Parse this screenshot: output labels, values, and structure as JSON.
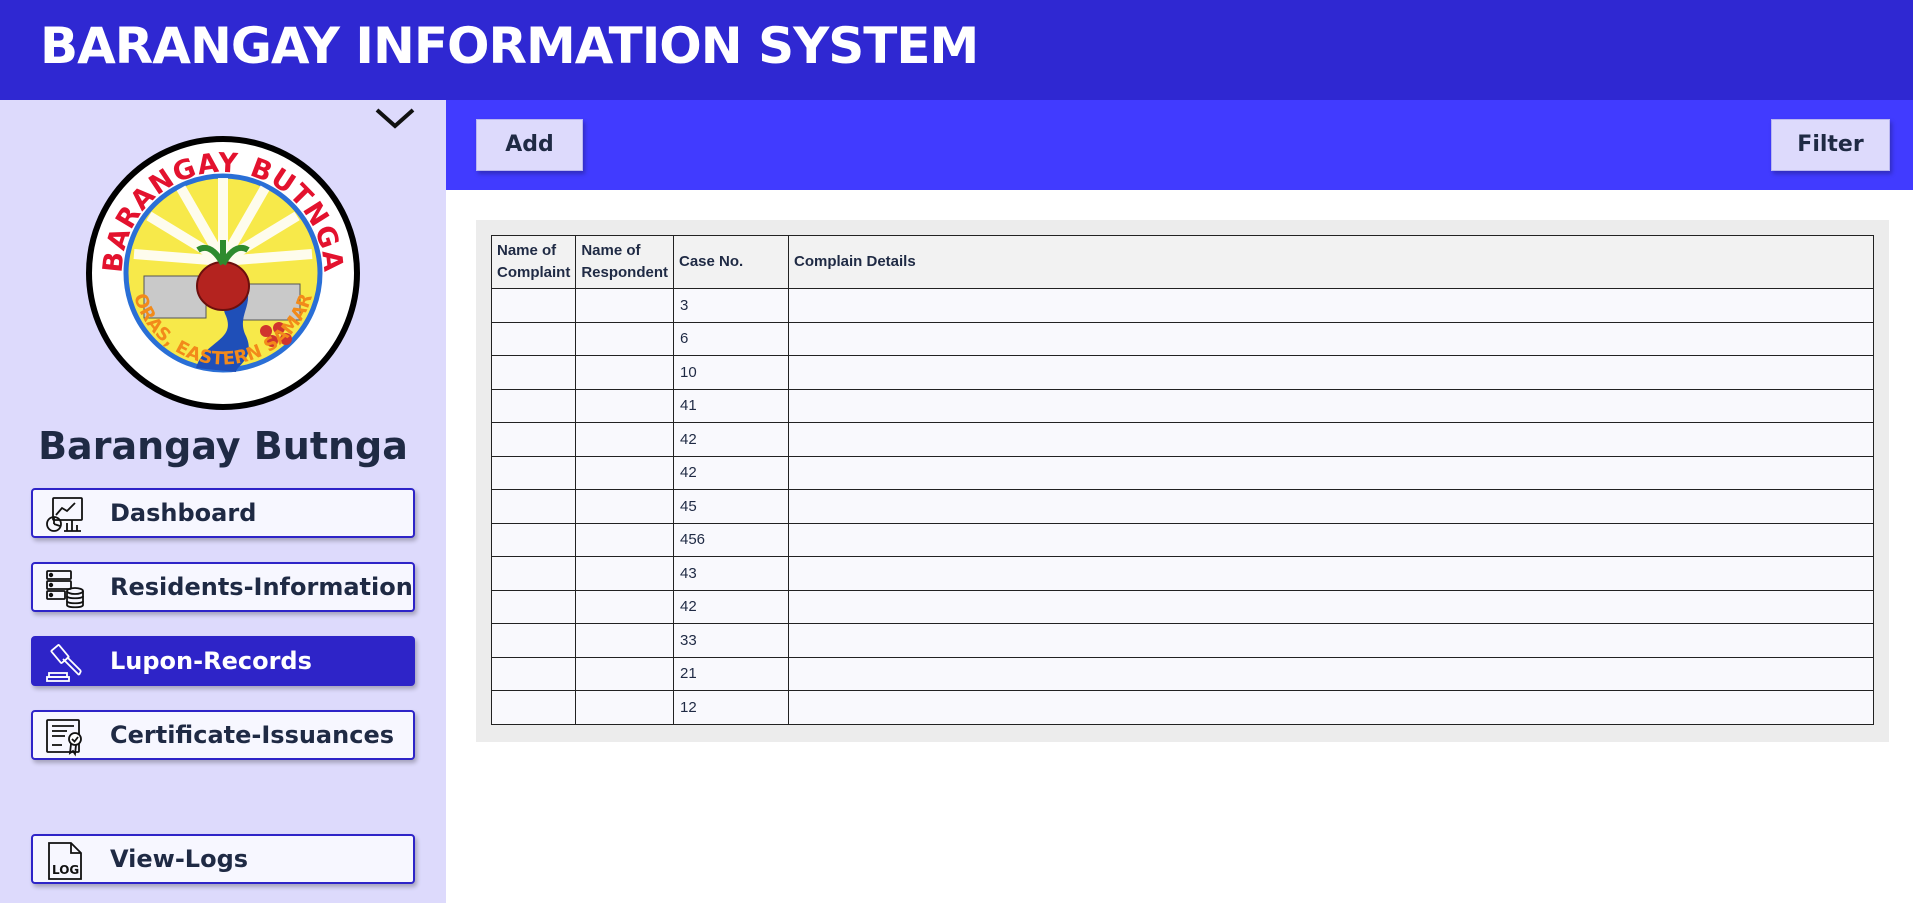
{
  "app": {
    "title": "BARANGAY INFORMATION SYSTEM"
  },
  "sidebar": {
    "barangay_name": "Barangay Butnga",
    "logo": {
      "top_text": "BARANGAY BUTNGA",
      "bottom_text": "ORAS, EASTERN SAMAR"
    },
    "collapse_icon": "chevron-down-icon",
    "items": [
      {
        "label": "Dashboard",
        "icon": "dashboard-icon",
        "active": false
      },
      {
        "label": "Residents-Information",
        "icon": "database-icon",
        "active": false
      },
      {
        "label": "Lupon-Records",
        "icon": "gavel-icon",
        "active": true
      },
      {
        "label": "Certificate-Issuances",
        "icon": "certificate-icon",
        "active": false
      },
      {
        "label": "View-Logs",
        "icon": "log-file-icon",
        "active": false
      }
    ]
  },
  "toolbar": {
    "add_label": "Add",
    "filter_label": "Filter"
  },
  "table": {
    "headers": [
      "Name of Complaint",
      "Name of Respondent",
      "Case No.",
      "Complain Details"
    ],
    "rows": [
      [
        "",
        "",
        "3",
        ""
      ],
      [
        "",
        "",
        "6",
        ""
      ],
      [
        "",
        "",
        "10",
        ""
      ],
      [
        "",
        "",
        "41",
        ""
      ],
      [
        "",
        "",
        "42",
        ""
      ],
      [
        "",
        "",
        "42",
        ""
      ],
      [
        "",
        "",
        "45",
        ""
      ],
      [
        "",
        "",
        "456",
        ""
      ],
      [
        "",
        "",
        "43",
        ""
      ],
      [
        "",
        "",
        "42",
        ""
      ],
      [
        "",
        "",
        "33",
        ""
      ],
      [
        "",
        "",
        "21",
        ""
      ],
      [
        "",
        "",
        "12",
        ""
      ]
    ]
  },
  "colors": {
    "header_bg": "#2f28d2",
    "toolbar_bg": "#413bff",
    "sidebar_bg": "#dddafc",
    "active_nav_bg": "#2e24c8"
  }
}
